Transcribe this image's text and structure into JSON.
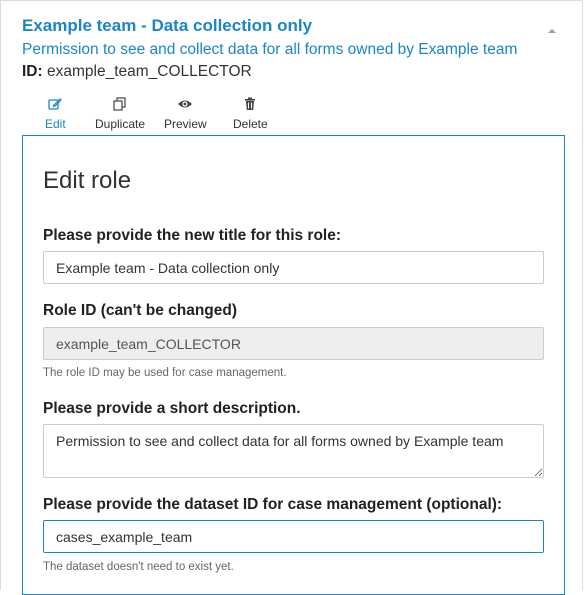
{
  "role": {
    "title": "Example team - Data collection only",
    "description": "Permission to see and collect data for all forms owned by Example team",
    "id_label": "ID:",
    "id_value": "example_team_COLLECTOR"
  },
  "actions": [
    {
      "label": "Edit",
      "icon": "edit-icon",
      "active": true
    },
    {
      "label": "Duplicate",
      "icon": "duplicate-icon",
      "active": false
    },
    {
      "label": "Preview",
      "icon": "eye-icon",
      "active": false
    },
    {
      "label": "Delete",
      "icon": "trash-icon",
      "active": false
    }
  ],
  "edit_form": {
    "heading": "Edit role",
    "title_label": "Please provide the new title for this role:",
    "title_value": "Example team - Data collection only",
    "role_id_label": "Role ID (can't be changed)",
    "role_id_value": "example_team_COLLECTOR",
    "role_id_help": "The role ID may be used for case management.",
    "description_label": "Please provide a short description.",
    "description_value": "Permission to see and collect data for all forms owned by Example team",
    "dataset_label": "Please provide the dataset ID for case management (optional):",
    "dataset_value": "cases_example_team",
    "dataset_help": "The dataset doesn't need to exist yet."
  },
  "colors": {
    "accent": "#1a86c8",
    "readonly_bg": "#eeeeee"
  }
}
